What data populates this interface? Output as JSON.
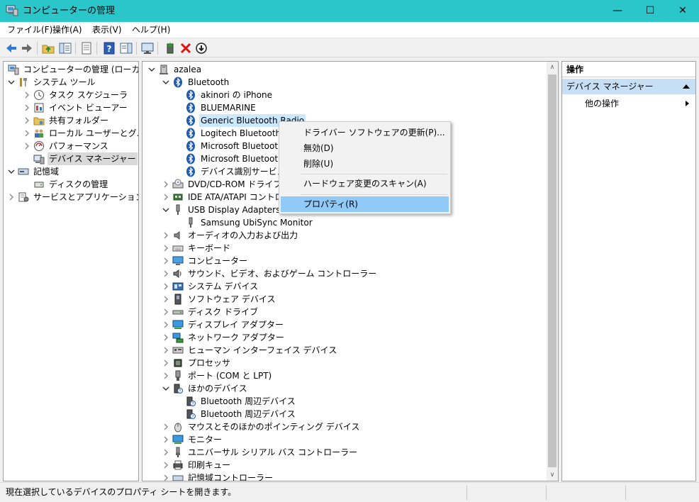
{
  "window": {
    "title": "コンピューターの管理",
    "minimize": "—",
    "maximize": "☐",
    "close": "✕"
  },
  "menu": [
    "ファイル(F)",
    "操作(A)",
    "表示(V)",
    "ヘルプ(H)"
  ],
  "toolbar_icons": [
    "back-arrow-icon",
    "forward-arrow-icon",
    "up-folder-icon",
    "show-hide-tree-icon",
    "properties-icon",
    "help-icon",
    "action-pane-icon",
    "computer-monitor-icon",
    "update-driver-icon",
    "uninstall-x-icon",
    "disable-device-icon"
  ],
  "left_tree": {
    "root": "コンピューターの管理 (ローカル)",
    "system_tools": "システム ツール",
    "task_scheduler": "タスク スケジューラ",
    "event_viewer": "イベント ビューアー",
    "shared_folders": "共有フォルダー",
    "local_users": "ローカル ユーザーとグループ",
    "performance": "パフォーマンス",
    "device_manager": "デバイス マネージャー",
    "storage": "記憶域",
    "disk_management": "ディスクの管理",
    "services_apps": "サービスとアプリケーション"
  },
  "device_tree": {
    "computer": "azalea",
    "bluetooth": "Bluetooth",
    "bt_children": [
      "akinori の iPhone",
      "BLUEMARINE",
      "Generic Bluetooth Radio",
      "Logitech Bluetooth M",
      "Microsoft Bluetooth",
      "Microsoft Bluetooth",
      "デバイス識別サービス"
    ],
    "dvd": "DVD/CD-ROM ドライブ",
    "ide": "IDE ATA/ATAPI コントロー",
    "usb_display": "USB Display Adapters",
    "samsung": "Samsung UbiSync Monitor",
    "categories_a": [
      "オーディオの入力および出力",
      "キーボード",
      "コンピューター",
      "サウンド、ビデオ、およびゲーム コントローラー",
      "システム デバイス",
      "ソフトウェア デバイス",
      "ディスク ドライブ",
      "ディスプレイ アダプター",
      "ネットワーク アダプター",
      "ヒューマン インターフェイス デバイス",
      "プロセッサ",
      "ポート (COM と LPT)"
    ],
    "other_devices": "ほかのデバイス",
    "other_children": [
      "Bluetooth 周辺デバイス",
      "Bluetooth 周辺デバイス"
    ],
    "categories_b": [
      "マウスとそのほかのポインティング デバイス",
      "モニター",
      "ユニバーサル シリアル バス コントローラー",
      "印刷キュー",
      "記憶域コントローラー"
    ]
  },
  "context_menu": {
    "update_driver": "ドライバー ソフトウェアの更新(P)...",
    "disable": "無効(D)",
    "uninstall": "削除(U)",
    "scan": "ハードウェア変更のスキャン(A)",
    "properties": "プロパティ(R)"
  },
  "actions_pane": {
    "header": "操作",
    "section": "デバイス マネージャー",
    "other_actions": "他の操作"
  },
  "status_bar": {
    "text": "現在選択しているデバイスのプロパティ シートを開きます。"
  }
}
